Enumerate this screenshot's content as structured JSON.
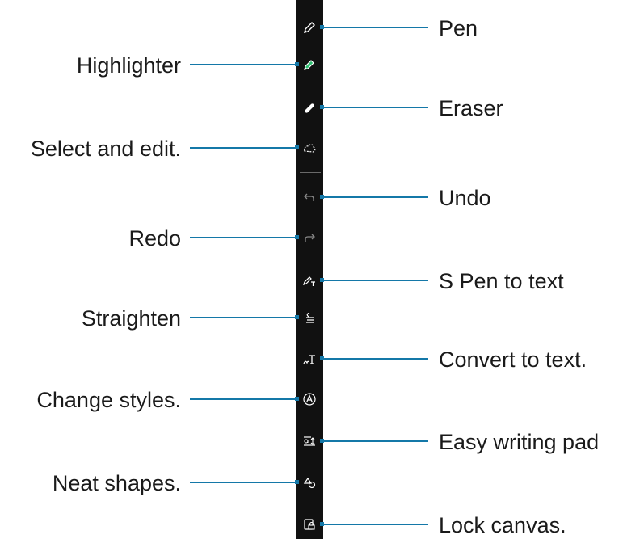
{
  "colors": {
    "toolbar": "#111111",
    "leader": "#1478a8",
    "highlighter": "#2fbf71"
  },
  "tools": [
    {
      "id": "pen",
      "label": "Pen",
      "icon": "pen-icon"
    },
    {
      "id": "highlighter",
      "label": "Highlighter",
      "icon": "highlighter-icon"
    },
    {
      "id": "eraser",
      "label": "Eraser",
      "icon": "eraser-icon"
    },
    {
      "id": "select",
      "label": "Select and edit.",
      "icon": "lasso-icon"
    },
    {
      "id": "undo",
      "label": "Undo",
      "icon": "undo-icon"
    },
    {
      "id": "redo",
      "label": "Redo",
      "icon": "redo-icon"
    },
    {
      "id": "spen",
      "label": "S Pen to text",
      "icon": "pen-to-text-icon"
    },
    {
      "id": "straighten",
      "label": "Straighten",
      "icon": "straighten-icon"
    },
    {
      "id": "convert",
      "label": "Convert to text.",
      "icon": "convert-text-icon"
    },
    {
      "id": "styles",
      "label": "Change styles.",
      "icon": "change-style-icon"
    },
    {
      "id": "pad",
      "label": "Easy writing pad",
      "icon": "writing-pad-icon"
    },
    {
      "id": "shapes",
      "label": "Neat shapes.",
      "icon": "shapes-icon"
    },
    {
      "id": "lock",
      "label": "Lock canvas.",
      "icon": "lock-canvas-icon"
    }
  ]
}
